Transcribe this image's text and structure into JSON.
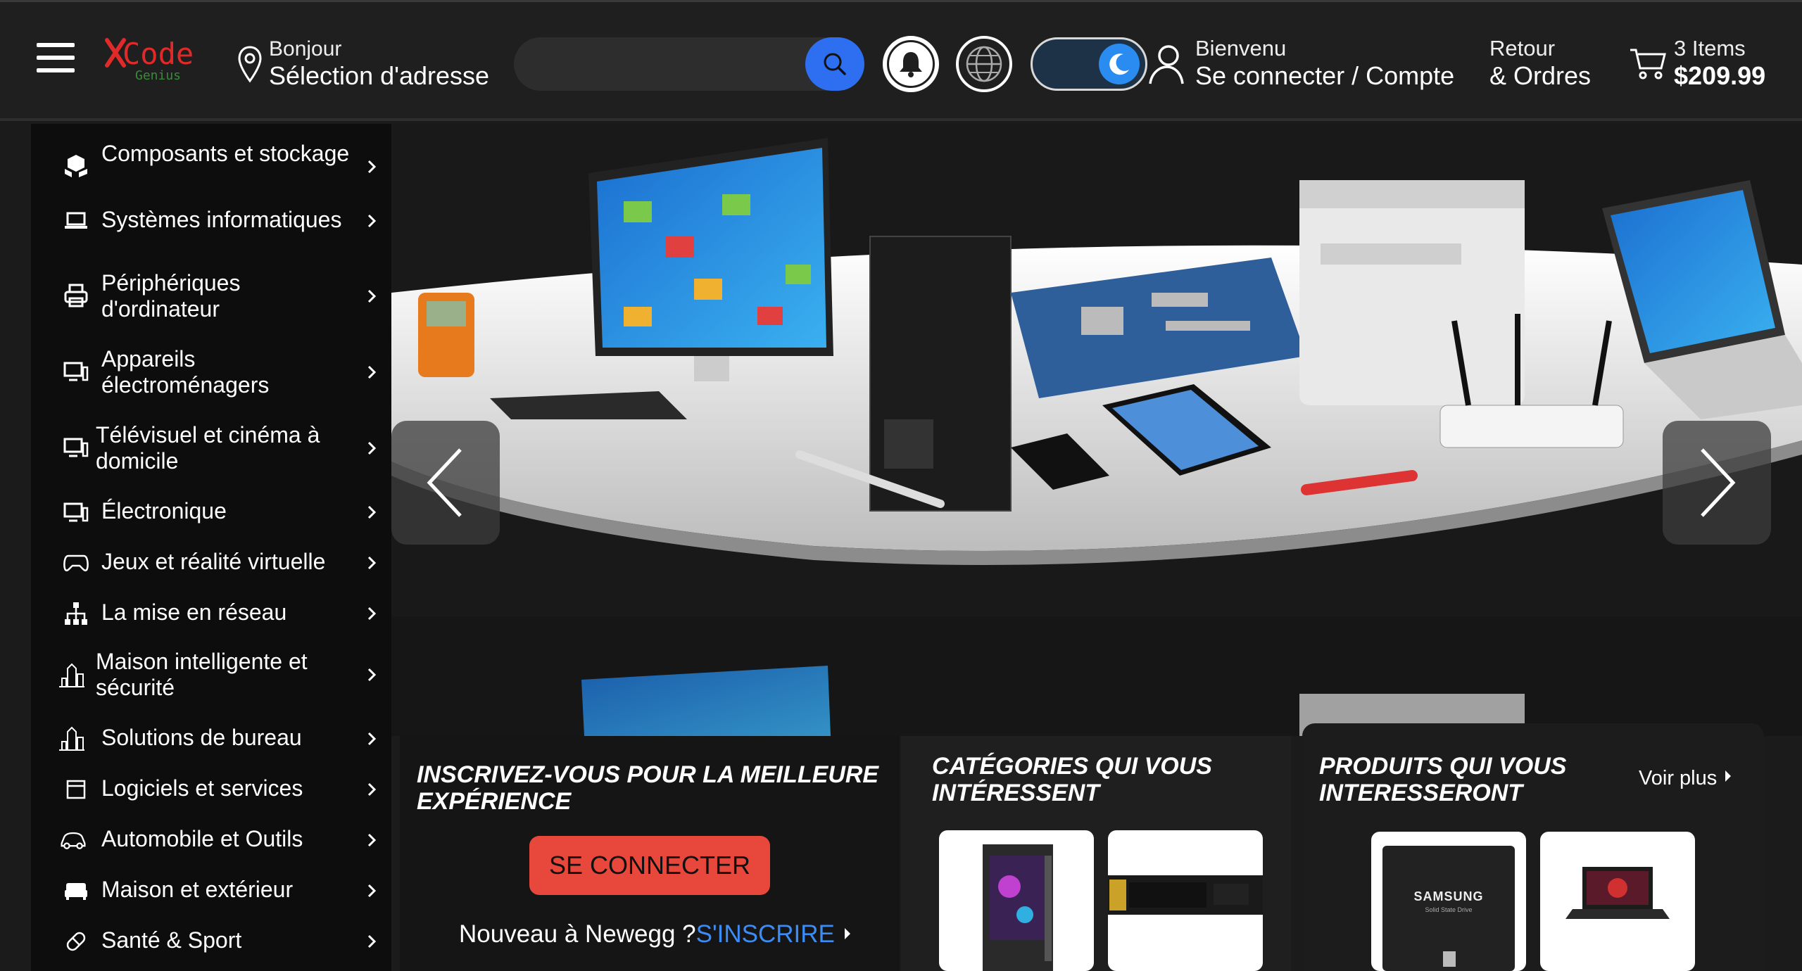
{
  "header": {
    "logo_text": "Code",
    "logo_sub": "Genius",
    "location_small": "Bonjour",
    "location_big": "Sélection d'adresse",
    "search_placeholder": "",
    "account_small": "Bienvenu",
    "account_big": "Se connecter / Compte",
    "orders_small": "Retour",
    "orders_big": "& Ordres",
    "cart_small": "3 Items",
    "cart_big": "$209.99"
  },
  "sidebar": {
    "items": [
      {
        "label": "Composants et stockage",
        "icon": "boxes-icon"
      },
      {
        "label": "Systèmes informatiques",
        "icon": "laptop-icon"
      },
      {
        "label": "Périphériques d'ordinateur",
        "icon": "printer-icon"
      },
      {
        "label": "Appareils électroménagers",
        "icon": "appliance-icon"
      },
      {
        "label": "Télévisuel et cinéma à domicile",
        "icon": "tv-icon"
      },
      {
        "label": "Électronique",
        "icon": "devices-icon"
      },
      {
        "label": "Jeux et réalité virtuelle",
        "icon": "gamepad-icon"
      },
      {
        "label": "La mise en réseau",
        "icon": "network-icon"
      },
      {
        "label": "Maison intelligente et sécurité",
        "icon": "city-icon"
      },
      {
        "label": "Solutions de bureau",
        "icon": "office-icon"
      },
      {
        "label": "Logiciels et services",
        "icon": "software-icon"
      },
      {
        "label": "Automobile et Outils",
        "icon": "car-icon"
      },
      {
        "label": "Maison et extérieur",
        "icon": "couch-icon"
      },
      {
        "label": "Santé & Sport",
        "icon": "health-icon"
      }
    ]
  },
  "signin": {
    "title": "INSCRIVEZ-VOUS POUR LA MEILLEURE EXPÉRIENCE",
    "button": "SE CONNECTER",
    "new_text": "Nouveau à Newegg ?",
    "new_link": "S'INSCRIRE"
  },
  "categories": {
    "title": "CATÉGORIES QUI VOUS INTÉRESSENT"
  },
  "products": {
    "title": "PRODUITS QUI VOUS INTERESSERONT",
    "voir_plus": "Voir plus",
    "ssd_brand": "SAMSUNG",
    "ssd_sub": "Solid State Drive"
  },
  "colors": {
    "accent_blue": "#2e6ff2",
    "cta_red": "#e8483b",
    "link_blue": "#3b8cf5"
  }
}
